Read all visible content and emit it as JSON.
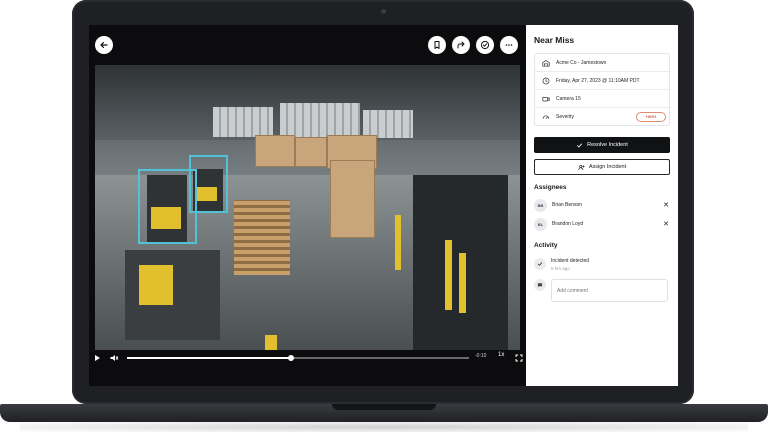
{
  "incident": {
    "title": "Near Miss",
    "details": [
      {
        "icon": "warehouse-icon",
        "text": "Acme Co - Jamestown"
      },
      {
        "icon": "clock-icon",
        "text": "Friday, Apr 27, 2023 @ 11:10AM PDT"
      },
      {
        "icon": "camera-icon",
        "text": "Camera 15"
      },
      {
        "icon": "gauge-icon",
        "text": "Severity"
      }
    ],
    "severity_badge": "HIGH",
    "severity_color": "#d0603f"
  },
  "actions": {
    "resolve_label": "Resolve Incident",
    "assign_label": "Assign Incident"
  },
  "assignees": {
    "title": "Assignees",
    "items": [
      {
        "initials": "BB",
        "name": "Brian Benson"
      },
      {
        "initials": "BL",
        "name": "Brandon Loyd"
      }
    ]
  },
  "activity": {
    "title": "Activity",
    "event_title": "Incident detected",
    "event_time": "5 hrs ago",
    "comment_placeholder": "Add comment"
  },
  "player": {
    "time_display": "-0:10",
    "speed": "1x",
    "progress": 0.48,
    "detection_color": "#53c1d6"
  },
  "toolbar": {
    "icons": [
      "back-arrow-icon",
      "bookmark-icon",
      "share-icon",
      "resolve-check-icon",
      "more-icon"
    ]
  }
}
